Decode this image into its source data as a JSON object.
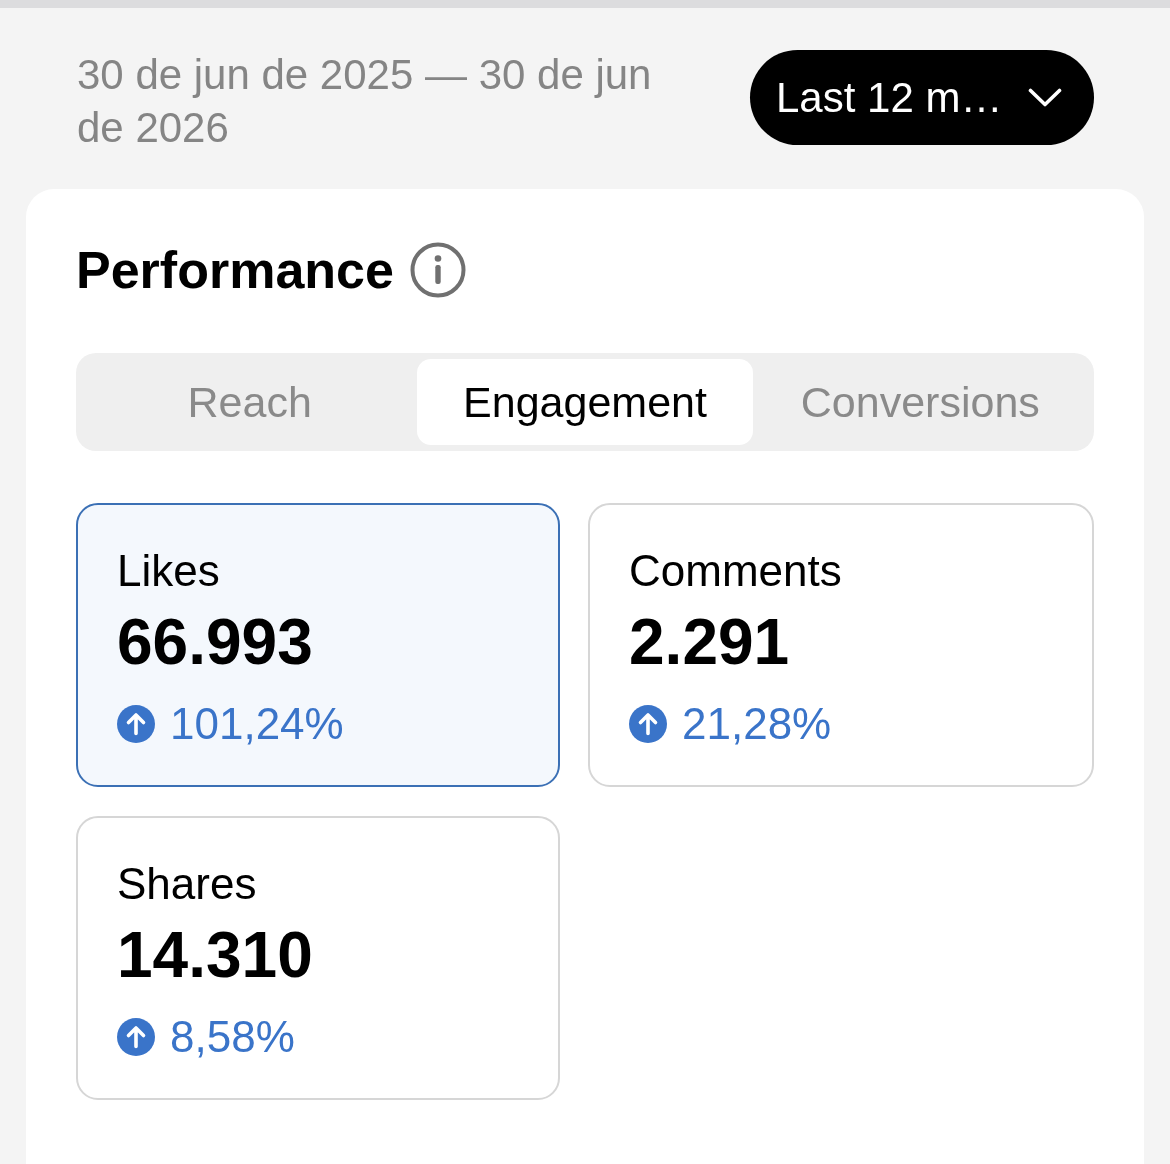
{
  "header": {
    "date_range": "30 de jun de 2025 — 30 de jun de 2026",
    "period_button": {
      "label": "Last 12 m…"
    }
  },
  "performance": {
    "title": "Performance",
    "tabs": [
      {
        "label": "Reach",
        "selected": false
      },
      {
        "label": "Engagement",
        "selected": true
      },
      {
        "label": "Conversions",
        "selected": false
      }
    ],
    "metrics": [
      {
        "label": "Likes",
        "value": "66.993",
        "change": "101,24%",
        "selected": true
      },
      {
        "label": "Comments",
        "value": "2.291",
        "change": "21,28%",
        "selected": false
      },
      {
        "label": "Shares",
        "value": "14.310",
        "change": "8,58%",
        "selected": false
      }
    ]
  }
}
